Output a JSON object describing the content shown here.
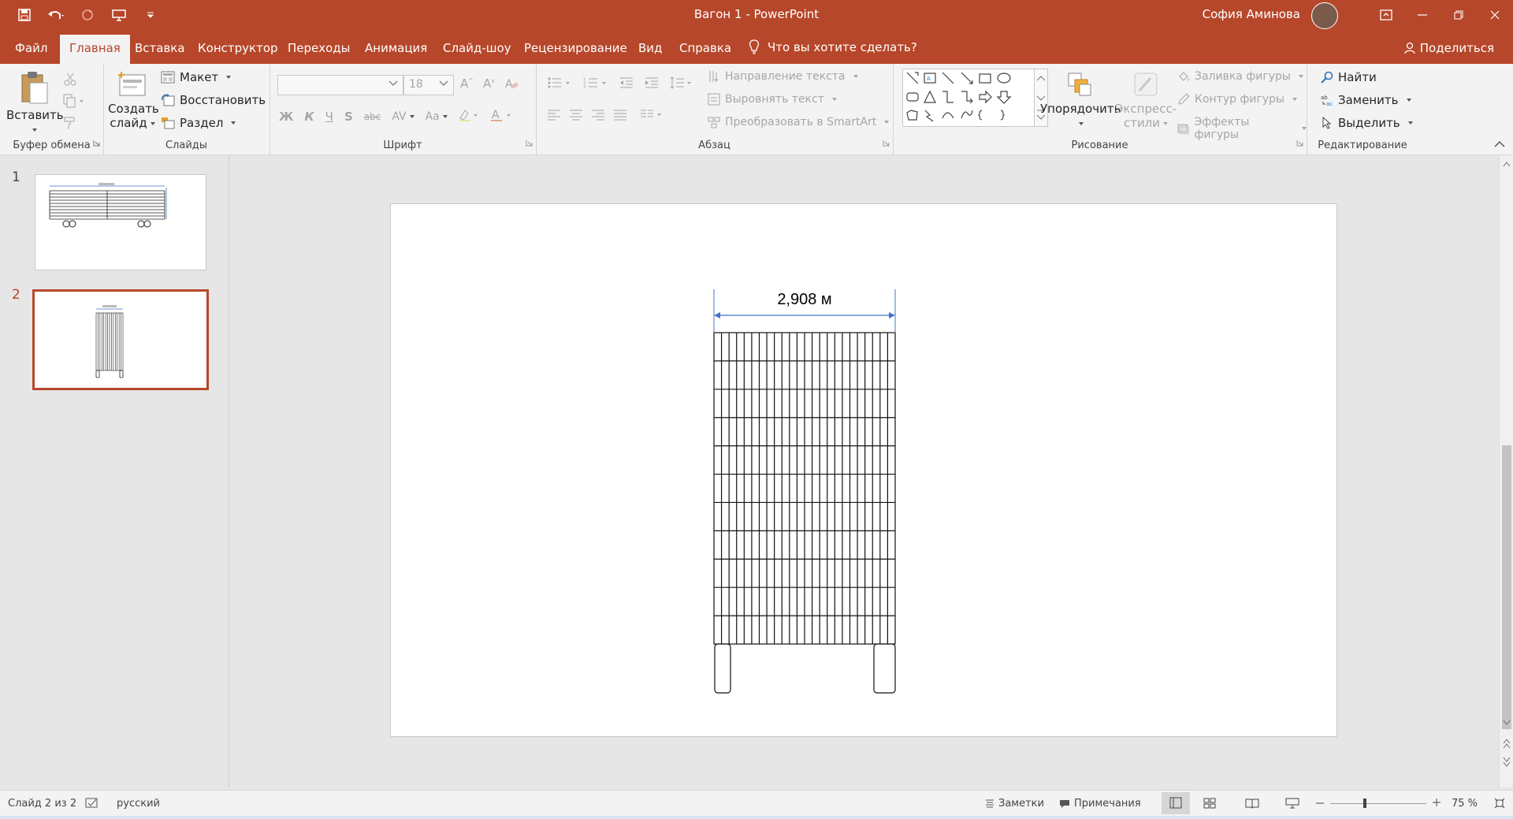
{
  "window": {
    "title": "Вагон 1  -  PowerPoint",
    "user": "София Аминова"
  },
  "tabs": {
    "file": "Файл",
    "home": "Главная",
    "insert": "Вставка",
    "design": "Конструктор",
    "transitions": "Переходы",
    "animations": "Анимация",
    "slideshow": "Слайд-шоу",
    "review": "Рецензирование",
    "view": "Вид",
    "help": "Справка",
    "tellme": "Что вы хотите сделать?",
    "share": "Поделиться"
  },
  "ribbon": {
    "clipboard": {
      "paste": "Вставить",
      "label": "Буфер обмена"
    },
    "slides": {
      "new_slide_1": "Создать",
      "new_slide_2": "слайд",
      "layout": "Макет",
      "reset": "Восстановить",
      "section": "Раздел",
      "label": "Слайды"
    },
    "font": {
      "size": "18",
      "label": "Шрифт"
    },
    "paragraph": {
      "text_direction": "Направление текста",
      "align_text": "Выровнять текст",
      "smartart": "Преобразовать в SmartArt",
      "label": "Абзац"
    },
    "drawing": {
      "arrange": "Упорядочить",
      "quick_styles_1": "Экспресс-",
      "quick_styles_2": "стили",
      "shape_fill": "Заливка фигуры",
      "shape_outline": "Контур фигуры",
      "shape_effects": "Эффекты фигуры",
      "label": "Рисование"
    },
    "editing": {
      "find": "Найти",
      "replace": "Заменить",
      "select": "Выделить",
      "label": "Редактирование"
    }
  },
  "slides_panel": {
    "slide1_number": "1",
    "slide2_number": "2"
  },
  "slide": {
    "dimension_label": "2,908 м"
  },
  "status": {
    "slide_info": "Слайд 2 из 2",
    "language": "русский",
    "notes": "Заметки",
    "comments": "Примечания",
    "zoom": "75 %"
  },
  "colors": {
    "accent": "#b7472a",
    "dimension_line": "#4472c4"
  }
}
